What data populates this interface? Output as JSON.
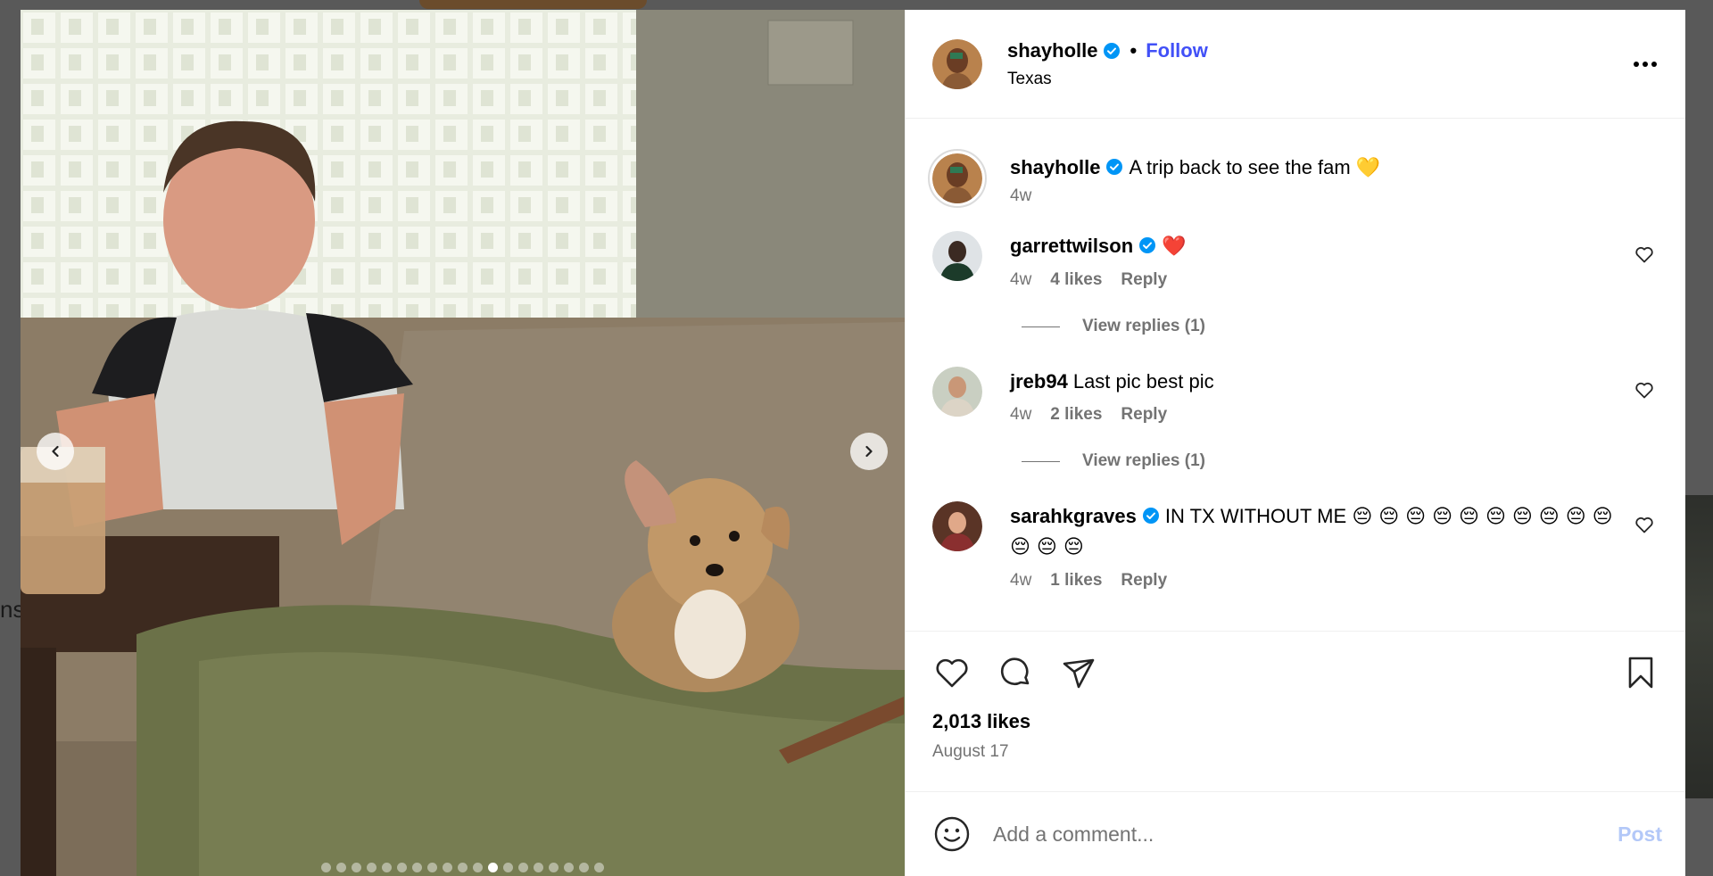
{
  "background": {
    "peek_text": "ns"
  },
  "post": {
    "author": "shayholle",
    "follow_label": "Follow",
    "separator": "•",
    "location": "Texas",
    "likes": "2,013 likes",
    "date": "August 17",
    "carousel": {
      "total": 19,
      "active_index": 11
    }
  },
  "caption": {
    "username": "shayholle",
    "text": "A trip back to see the fam",
    "emoji": "💛",
    "time": "4w"
  },
  "comments": [
    {
      "username": "garrettwilson",
      "verified": true,
      "text": "",
      "emoji": "❤️",
      "time": "4w",
      "likes": "4 likes",
      "reply": "Reply",
      "view_replies": "View replies (1)"
    },
    {
      "username": "jreb94",
      "verified": false,
      "text": "Last pic best pic",
      "emoji": "",
      "time": "4w",
      "likes": "2 likes",
      "reply": "Reply",
      "view_replies": "View replies (1)"
    },
    {
      "username": "sarahkgraves",
      "verified": true,
      "text": "IN TX WITHOUT ME",
      "emoji": "😔 😔 😔 😔 😔 😔 😔 😔 😔 😔 😔 😔 😔",
      "time": "4w",
      "likes": "1 likes",
      "reply": "Reply"
    }
  ],
  "comment_box": {
    "placeholder": "Add a comment...",
    "post_label": "Post"
  },
  "colors": {
    "link": "#4150f7",
    "verified": "#0095f6",
    "muted": "#737373",
    "post_disabled": "#b3c8f8"
  },
  "icons": [
    "chevron-left-icon",
    "chevron-right-icon",
    "verified-icon",
    "more-icon",
    "heart-icon",
    "comment-icon",
    "share-icon",
    "bookmark-icon",
    "smiley-icon"
  ]
}
